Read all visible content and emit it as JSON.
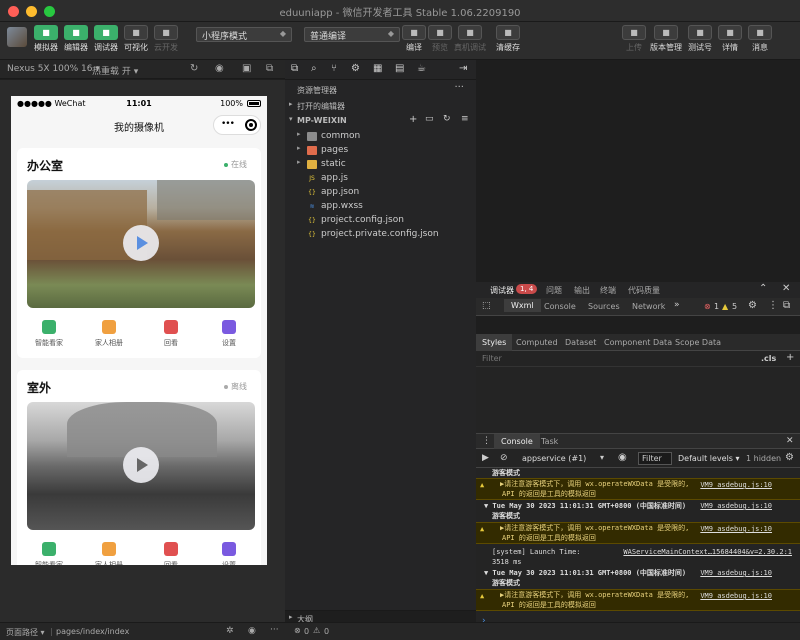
{
  "window": {
    "title": "eduuniapp - 微信开发者工具 Stable 1.06.2209190"
  },
  "toolbar": {
    "left": [
      {
        "label": "模拟器",
        "icon": "phone-icon"
      },
      {
        "label": "编辑器",
        "icon": "code-icon"
      },
      {
        "label": "调试器",
        "icon": "debug-icon"
      },
      {
        "label": "可视化",
        "icon": "visual-icon"
      },
      {
        "label": "云开发",
        "icon": "cloud-icon"
      }
    ],
    "mode_select": "小程序模式",
    "compile_select": "普通编译",
    "mid": [
      {
        "label": "编译",
        "icon": "refresh-icon"
      },
      {
        "label": "预览",
        "icon": "eye-icon"
      },
      {
        "label": "真机调试",
        "icon": "bug-icon"
      },
      {
        "label": "清缓存",
        "icon": "database-icon"
      }
    ],
    "right": [
      {
        "label": "上传",
        "icon": "upload-icon"
      },
      {
        "label": "版本管理",
        "icon": "branch-icon"
      },
      {
        "label": "测试号",
        "icon": "test-icon"
      },
      {
        "label": "详情",
        "icon": "menu-icon"
      },
      {
        "label": "消息",
        "icon": "bell-icon"
      }
    ]
  },
  "simulator": {
    "device": "Nexus 5X 100% 16 ▾",
    "hot_reload": "热重载 开 ▾",
    "statusbar": {
      "carrier": "●●●●● WeChat",
      "time": "11:01",
      "battery": "100%"
    },
    "nav_title": "我的摄像机",
    "cards": [
      {
        "title": "办公室",
        "status": "在线",
        "status_color": "#3bb06b",
        "actions": [
          {
            "label": "智能看家",
            "color": "#3bb06b"
          },
          {
            "label": "家人相册",
            "color": "#f0a040"
          },
          {
            "label": "回看",
            "color": "#e05050"
          },
          {
            "label": "设置",
            "color": "#7a5ae0"
          }
        ]
      },
      {
        "title": "室外",
        "status": "离线",
        "status_color": "#aaaaaa",
        "actions": [
          {
            "label": "智能看家",
            "color": "#3bb06b"
          },
          {
            "label": "家人相册",
            "color": "#f0a040"
          },
          {
            "label": "回看",
            "color": "#e05050"
          },
          {
            "label": "设置",
            "color": "#7a5ae0"
          }
        ]
      }
    ]
  },
  "explorer": {
    "header": "资源管理器",
    "open_editors": "打开的编辑器",
    "project": "MP-WEIXIN",
    "files": [
      {
        "name": "common",
        "type": "folder",
        "icon": "folder-icon",
        "color": "#8c8c8c"
      },
      {
        "name": "pages",
        "type": "folder",
        "icon": "folder-icon",
        "color": "#e06c4c"
      },
      {
        "name": "static",
        "type": "folder",
        "icon": "folder-icon",
        "color": "#e0b040"
      },
      {
        "name": "app.js",
        "type": "file",
        "icon": "js-icon",
        "color": "#e5c83a"
      },
      {
        "name": "app.json",
        "type": "file",
        "icon": "json-icon",
        "color": "#e5c83a"
      },
      {
        "name": "app.wxss",
        "type": "file",
        "icon": "css-icon",
        "color": "#4a90e2"
      },
      {
        "name": "project.config.json",
        "type": "file",
        "icon": "json-icon",
        "color": "#e5c83a"
      },
      {
        "name": "project.private.config.json",
        "type": "file",
        "icon": "json-icon",
        "color": "#e5c83a"
      }
    ],
    "outline": "大纲"
  },
  "devtools": {
    "top_tabs": [
      "调试器",
      "问题",
      "输出",
      "终端",
      "代码质量"
    ],
    "debug_badge": "1, 4",
    "panel_tabs": [
      "Wxml",
      "Console",
      "Sources",
      "Network"
    ],
    "error_count": "1",
    "warn_count": "5",
    "style_tabs": [
      "Styles",
      "Computed",
      "Dataset",
      "Component Data",
      "Scope Data"
    ],
    "filter_placeholder": "Filter",
    "cls": ".cls",
    "console_tabs": [
      "Console",
      "Task"
    ],
    "context": "appservice (#1)",
    "console_filter": "Filter",
    "levels": "Default levels ▾",
    "hidden": "1 hidden",
    "logs": {
      "partial": "游客模式",
      "w1a": "▶请注意游客模式下，调用 wx.operateWXData 是受限的,",
      "w1b": "API 的返回是工具的模拟返回",
      "w1link": "VM9 asdebug.js:10",
      "g1a": "▼ Tue May 30 2023 11:01:31 GMT+0800 (中国标准时间)",
      "g1b": "游客模式",
      "g1link": "VM9 asdebug.js:10",
      "w2a": "▶请注意游客模式下，调用 wx.operateWXData 是受限的,",
      "w2b": "API 的返回是工具的模拟返回",
      "w2link": "VM9 asdebug.js:10",
      "sys1": "[system] Launch Time:",
      "sys1link": "WAServiceMainContext…15684404&v=2.30.2:1",
      "sys2": "3518 ms",
      "g2a": "▼ Tue May 30 2023 11:01:31 GMT+0800 (中国标准时间)",
      "g2b": "游客模式",
      "g2link": "VM9 asdebug.js:10",
      "w3a": "▶请注意游客模式下，调用 wx.operateWXData 是受限的,",
      "w3b": "API 的返回是工具的模拟返回",
      "w3link": "VM9 asdebug.js:10"
    }
  },
  "statusbar": {
    "path_label": "页面路径 ▾",
    "path": "pages/index/index",
    "errors": "0",
    "warnings": "0"
  }
}
